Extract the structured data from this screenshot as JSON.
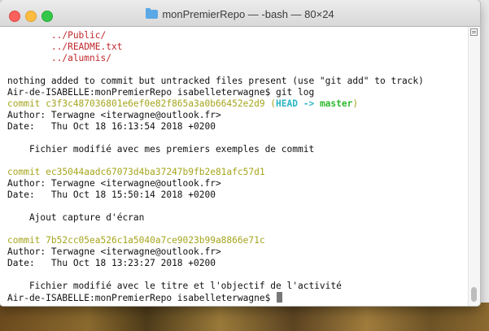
{
  "window": {
    "title": "monPremierRepo — -bash — 80×24"
  },
  "terminal": {
    "lines": [
      {
        "parts": [
          {
            "text": "        ../Public/",
            "color": "red"
          }
        ]
      },
      {
        "parts": [
          {
            "text": "        ../README.txt",
            "color": "red"
          }
        ]
      },
      {
        "parts": [
          {
            "text": "        ../alumnis/",
            "color": "red"
          }
        ]
      },
      {
        "parts": [
          {
            "text": ""
          }
        ]
      },
      {
        "parts": [
          {
            "text": "nothing added to commit but untracked files present (use \"git add\" to track)"
          }
        ]
      },
      {
        "parts": [
          {
            "text": "Air-de-ISABELLE:monPremierRepo isabelleterwagne$ git log"
          }
        ]
      },
      {
        "parts": [
          {
            "text": "commit c3f3c487036801e6ef0e82f865a3a0b66452e2d9 (",
            "color": "yellow"
          },
          {
            "text": "HEAD -> ",
            "color": "cyan"
          },
          {
            "text": "master",
            "color": "green"
          },
          {
            "text": ")",
            "color": "yellow"
          }
        ]
      },
      {
        "parts": [
          {
            "text": "Author: Terwagne <iterwagne@outlook.fr>"
          }
        ]
      },
      {
        "parts": [
          {
            "text": "Date:   Thu Oct 18 16:13:54 2018 +0200"
          }
        ]
      },
      {
        "parts": [
          {
            "text": ""
          }
        ]
      },
      {
        "parts": [
          {
            "text": "    Fichier modifié avec mes premiers exemples de commit"
          }
        ]
      },
      {
        "parts": [
          {
            "text": ""
          }
        ]
      },
      {
        "parts": [
          {
            "text": "commit ec35044aadc67073d4ba37247b9fb2e81afc57d1",
            "color": "yellow"
          }
        ]
      },
      {
        "parts": [
          {
            "text": "Author: Terwagne <iterwagne@outlook.fr>"
          }
        ]
      },
      {
        "parts": [
          {
            "text": "Date:   Thu Oct 18 15:50:14 2018 +0200"
          }
        ]
      },
      {
        "parts": [
          {
            "text": ""
          }
        ]
      },
      {
        "parts": [
          {
            "text": "    Ajout capture d'écran"
          }
        ]
      },
      {
        "parts": [
          {
            "text": ""
          }
        ]
      },
      {
        "parts": [
          {
            "text": "commit 7b52cc05ea526c1a5040a7ce9023b99a8866e71c",
            "color": "yellow"
          }
        ]
      },
      {
        "parts": [
          {
            "text": "Author: Terwagne <iterwagne@outlook.fr>"
          }
        ]
      },
      {
        "parts": [
          {
            "text": "Date:   Thu Oct 18 13:23:27 2018 +0200"
          }
        ]
      },
      {
        "parts": [
          {
            "text": ""
          }
        ]
      },
      {
        "parts": [
          {
            "text": "    Fichier modifié avec le titre et l'objectif de l'activité"
          }
        ]
      },
      {
        "parts": [
          {
            "text": "Air-de-ISABELLE:monPremierRepo isabelleterwagne$ "
          }
        ],
        "cursor": true
      }
    ]
  },
  "icons": {
    "title_icon": "folder-icon"
  },
  "colors": {
    "red": "#c0282c",
    "yellow": "#a5a51e",
    "cyan": "#2bb5c5",
    "green": "#2eb82e"
  }
}
